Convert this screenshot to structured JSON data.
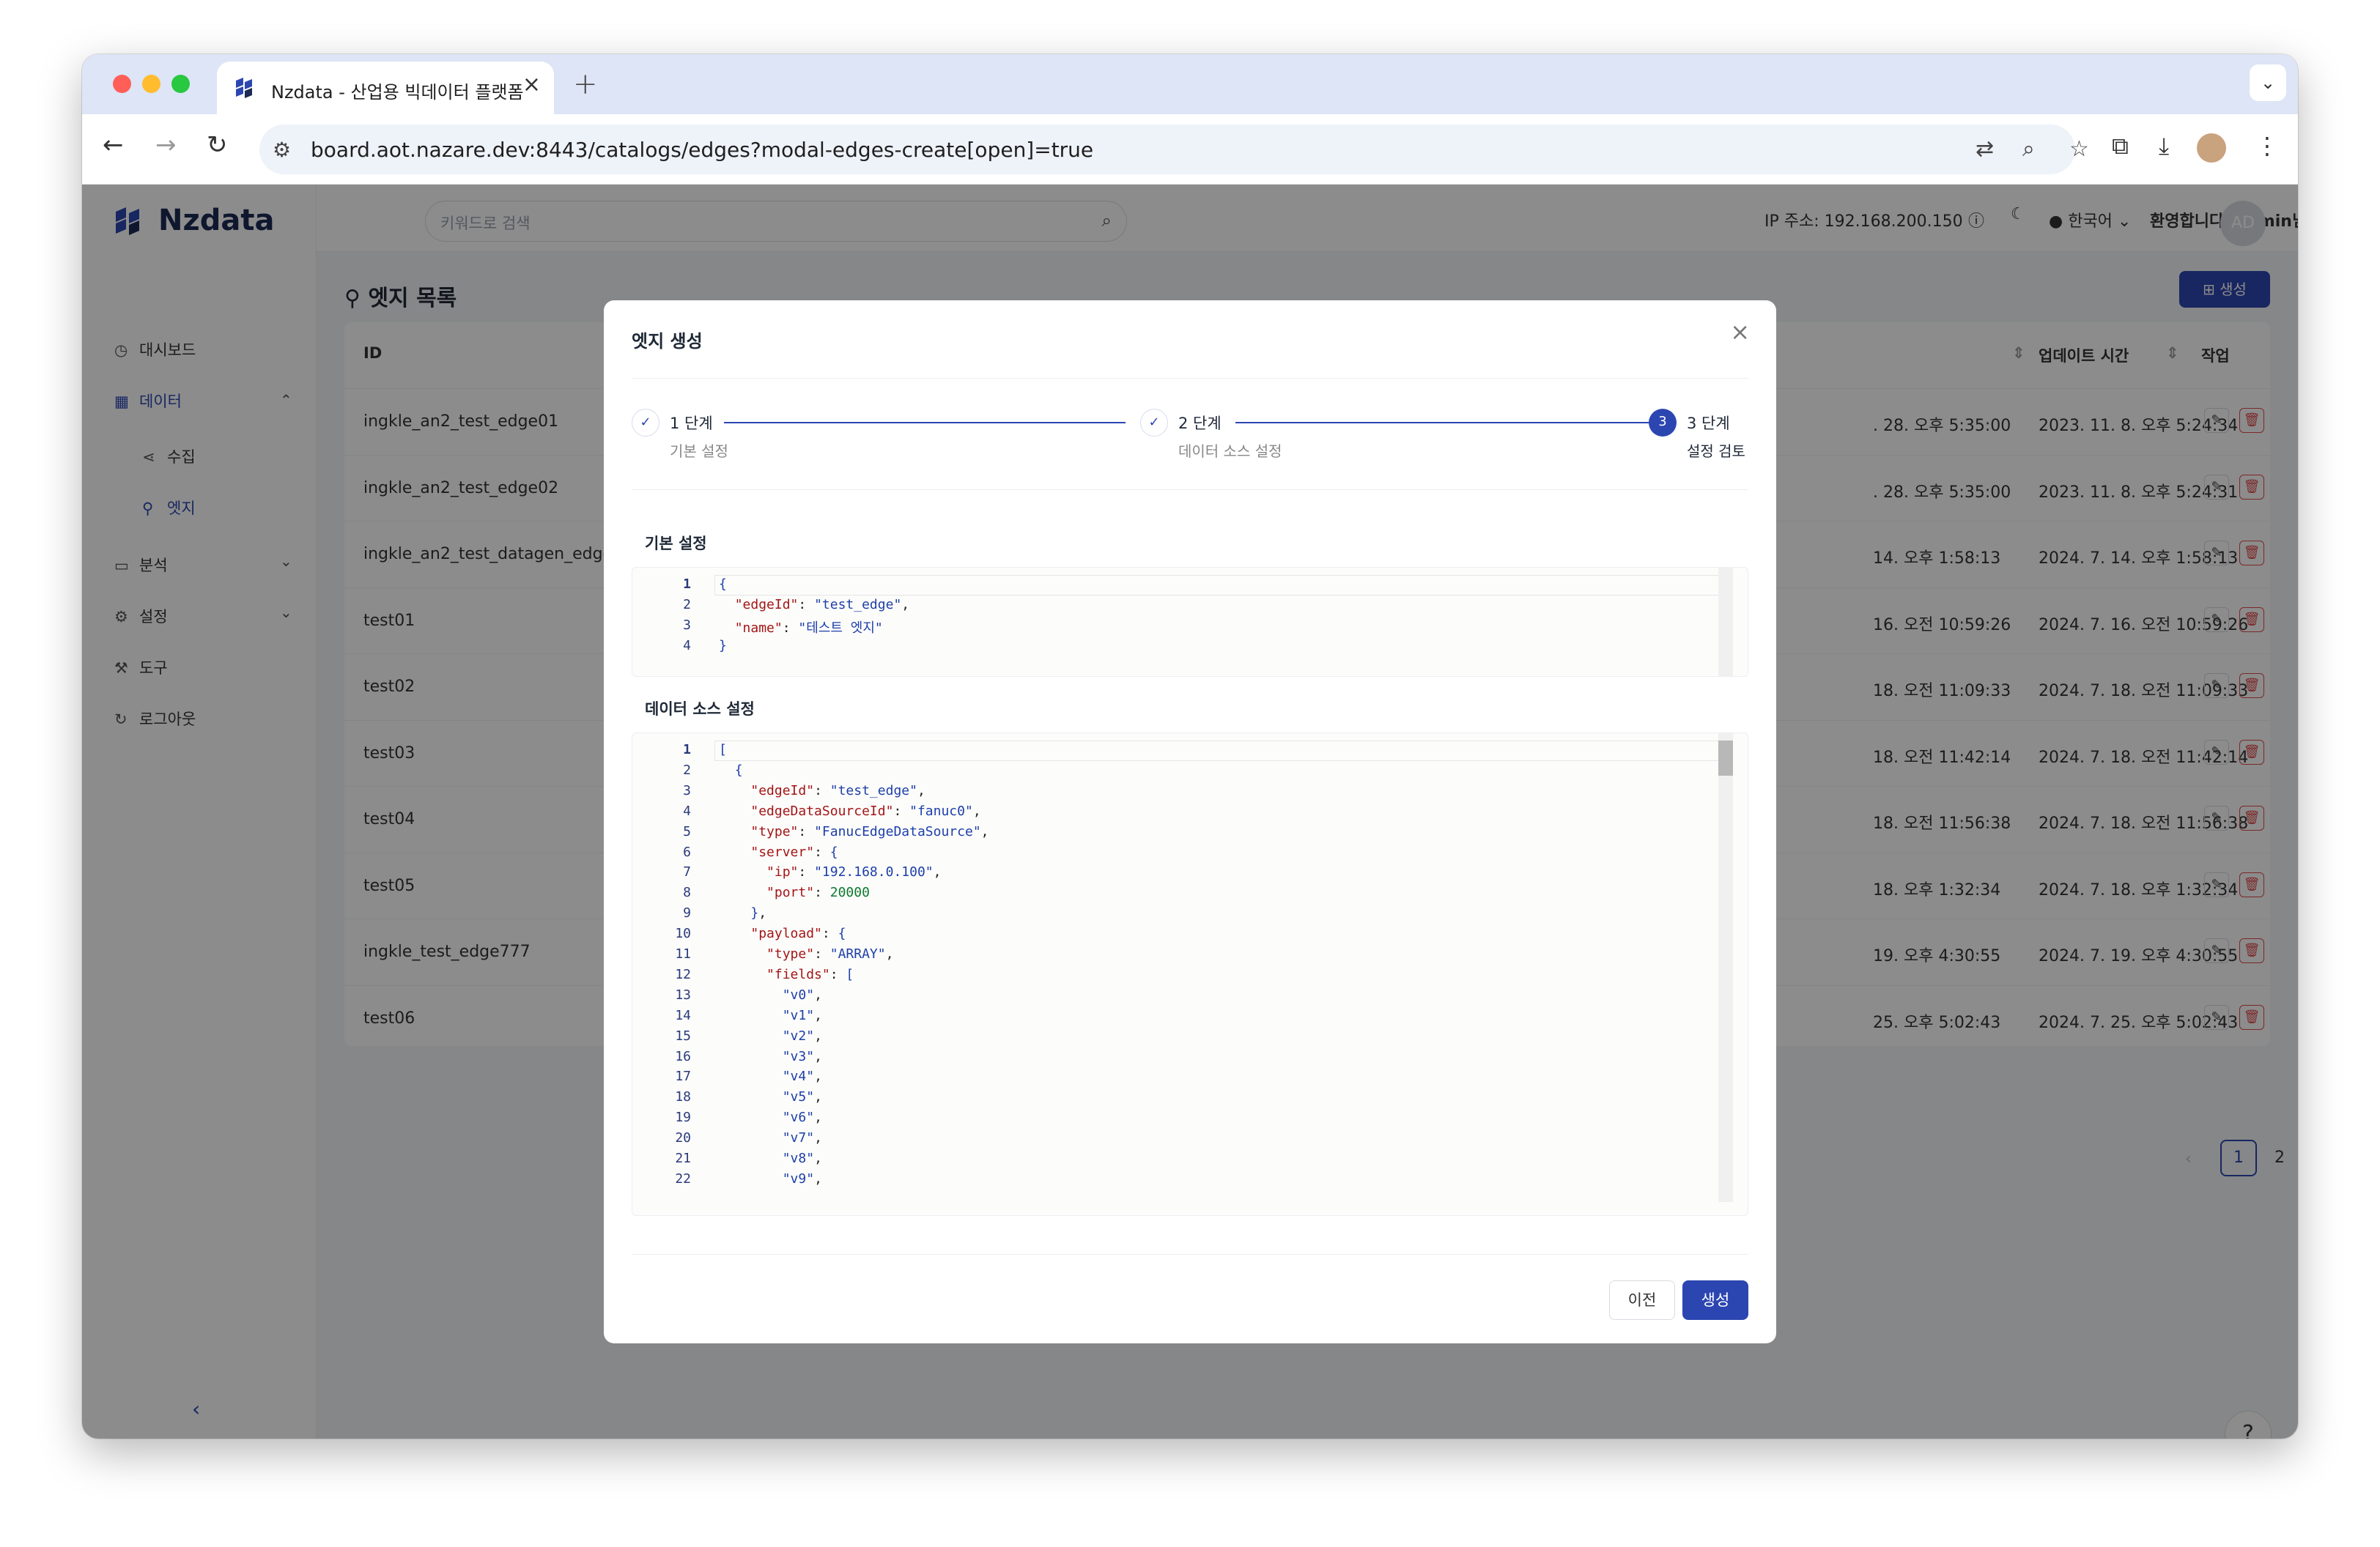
{
  "browser": {
    "tab_title": "Nzdata - 산업용 빅데이터 플랫폼",
    "url": "board.aot.nazare.dev:8443/catalogs/edges?modal-edges-create[open]=true"
  },
  "app": {
    "logo": "Nzdata",
    "search_placeholder": "키워드로 검색",
    "ip_label": "IP 주소: 192.168.200.150",
    "language": "한국어",
    "welcome": "환영합니다, admin님",
    "avatar_initials": "AD"
  },
  "sidebar": {
    "items": [
      {
        "label": "대시보드"
      },
      {
        "label": "데이터"
      },
      {
        "label": "수집"
      },
      {
        "label": "엣지"
      },
      {
        "label": "분석"
      },
      {
        "label": "설정"
      },
      {
        "label": "도구"
      },
      {
        "label": "로그아웃"
      }
    ]
  },
  "page": {
    "title": "엣지 목록",
    "create_label": "생성",
    "columns": {
      "id": "ID",
      "updated": "업데이트 시간",
      "actions": "작업"
    },
    "rows": [
      {
        "id": "ingkle_an2_test_edge01",
        "created": ". 28. 오후 5:35:00",
        "updated": "2023. 11. 8. 오후 5:24:34"
      },
      {
        "id": "ingkle_an2_test_edge02",
        "created": ". 28. 오후 5:35:00",
        "updated": "2023. 11. 8. 오후 5:24:31"
      },
      {
        "id": "ingkle_an2_test_datagen_edge",
        "created": "14. 오후 1:58:13",
        "updated": "2024. 7. 14. 오후 1:58:13"
      },
      {
        "id": "test01",
        "created": "16. 오전 10:59:26",
        "updated": "2024. 7. 16. 오전 10:59:26"
      },
      {
        "id": "test02",
        "created": "18. 오전 11:09:33",
        "updated": "2024. 7. 18. 오전 11:09:33"
      },
      {
        "id": "test03",
        "created": "18. 오전 11:42:14",
        "updated": "2024. 7. 18. 오전 11:42:14"
      },
      {
        "id": "test04",
        "created": "18. 오전 11:56:38",
        "updated": "2024. 7. 18. 오전 11:56:38"
      },
      {
        "id": "test05",
        "created": "18. 오후 1:32:34",
        "updated": "2024. 7. 18. 오후 1:32:34"
      },
      {
        "id": "ingkle_test_edge777",
        "created": "19. 오후 4:30:55",
        "updated": "2024. 7. 19. 오후 4:30:55"
      },
      {
        "id": "test06",
        "created": "25. 오후 5:02:43",
        "updated": "2024. 7. 25. 오후 5:02:43"
      }
    ],
    "pagination": {
      "current": "1",
      "next_page": "2"
    }
  },
  "modal": {
    "title": "엣지 생성",
    "steps": [
      {
        "num": "1",
        "label": "1 단계",
        "sub": "기본 설정",
        "state": "done"
      },
      {
        "num": "2",
        "label": "2 단계",
        "sub": "데이터 소스 설정",
        "state": "done"
      },
      {
        "num": "3",
        "label": "3 단계",
        "sub": "설정 검토",
        "state": "current"
      }
    ],
    "section1_label": "기본 설정",
    "section2_label": "데이터 소스 설정",
    "basic_code": [
      "{",
      "  \"edgeId\": \"test_edge\",",
      "  \"name\": \"테스트 엣지\"",
      "}"
    ],
    "source_code": [
      "[",
      "  {",
      "    \"edgeId\": \"test_edge\",",
      "    \"edgeDataSourceId\": \"fanuc0\",",
      "    \"type\": \"FanucEdgeDataSource\",",
      "    \"server\": {",
      "      \"ip\": \"192.168.0.100\",",
      "      \"port\": 20000",
      "    },",
      "    \"payload\": {",
      "      \"type\": \"ARRAY\",",
      "      \"fields\": [",
      "        \"v0\",",
      "        \"v1\",",
      "        \"v2\",",
      "        \"v3\",",
      "        \"v4\",",
      "        \"v5\",",
      "        \"v6\",",
      "        \"v7\",",
      "        \"v8\",",
      "        \"v9\","
    ],
    "prev_label": "이전",
    "create_label": "생성"
  },
  "colors": {
    "accent": "#2c46b1",
    "danger": "#e24a4a"
  }
}
